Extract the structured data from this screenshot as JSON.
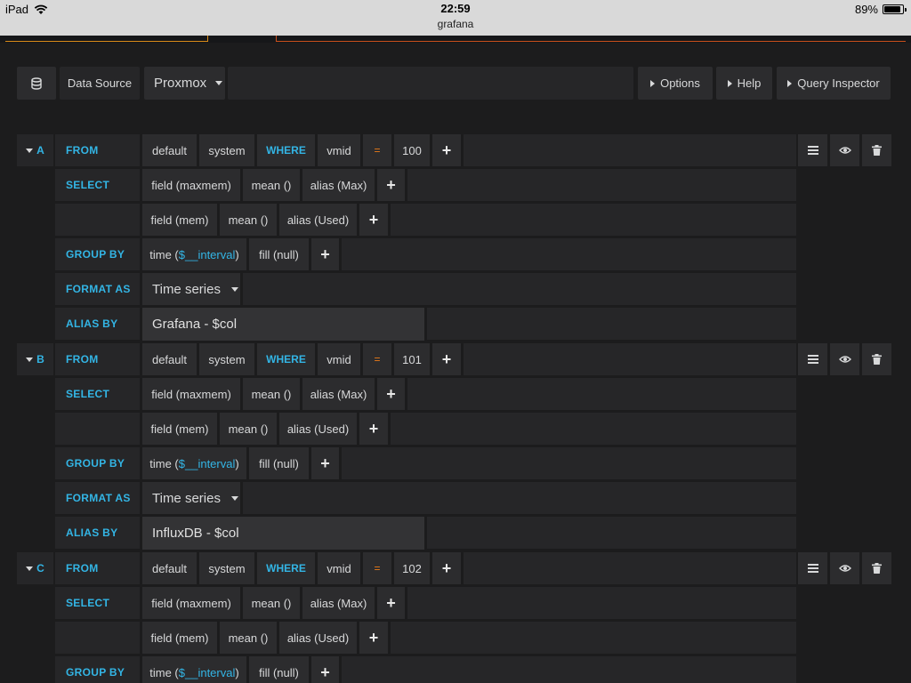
{
  "status_bar": {
    "device": "iPad",
    "time": "22:59",
    "subtitle": "grafana",
    "battery": "89%",
    "battery_level": 0.89
  },
  "toolbar": {
    "datasource_icon": "database-icon",
    "datasource_label": "Data Source",
    "datasource_value": "Proxmox",
    "options": "Options",
    "help": "Help",
    "query_inspector": "Query Inspector"
  },
  "labels": {
    "from": "FROM",
    "select": "SELECT",
    "group_by": "GROUP BY",
    "format_as": "FORMAT AS",
    "alias_by": "ALIAS BY",
    "where": "WHERE",
    "equals": "=",
    "plus": "+"
  },
  "queries": [
    {
      "letter": "A",
      "policy": "default",
      "measurement": "system",
      "tag": "vmid",
      "value": "100",
      "select_rows": [
        [
          "field (maxmem)",
          "mean ()",
          "alias (Max)"
        ],
        [
          "field (mem)",
          "mean ()",
          "alias (Used)"
        ]
      ],
      "group_by": {
        "time_prefix": "time (",
        "time_var": "$__interval",
        "time_suffix": ")",
        "fill": "fill (null)"
      },
      "format_as": "Time series",
      "alias": "Grafana - $col"
    },
    {
      "letter": "B",
      "policy": "default",
      "measurement": "system",
      "tag": "vmid",
      "value": "101",
      "select_rows": [
        [
          "field (maxmem)",
          "mean ()",
          "alias (Max)"
        ],
        [
          "field (mem)",
          "mean ()",
          "alias (Used)"
        ]
      ],
      "group_by": {
        "time_prefix": "time (",
        "time_var": "$__interval",
        "time_suffix": ")",
        "fill": "fill (null)"
      },
      "format_as": "Time series",
      "alias": "InfluxDB - $col"
    },
    {
      "letter": "C",
      "policy": "default",
      "measurement": "system",
      "tag": "vmid",
      "value": "102",
      "select_rows": [
        [
          "field (maxmem)",
          "mean ()",
          "alias (Max)"
        ],
        [
          "field (mem)",
          "mean ()",
          "alias (Used)"
        ]
      ],
      "group_by": {
        "time_prefix": "time (",
        "time_var": "$__interval",
        "time_suffix": ")",
        "fill": "fill (null)"
      }
    }
  ],
  "row_icons": [
    "menu-icon",
    "eye-icon",
    "trash-icon"
  ]
}
